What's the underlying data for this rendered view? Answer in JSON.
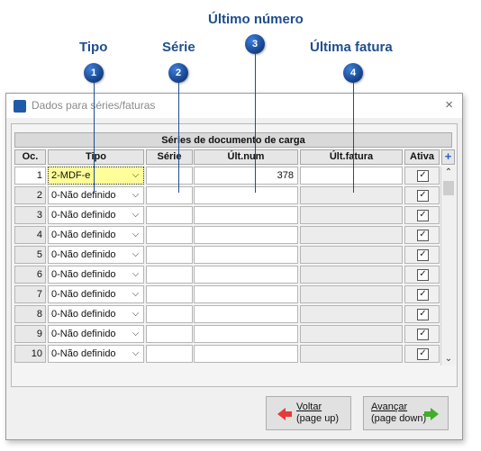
{
  "callouts": [
    {
      "title": "Tipo",
      "num": "1"
    },
    {
      "title": "Série",
      "num": "2"
    },
    {
      "title": "Último número",
      "num": "3"
    },
    {
      "title": "Última fatura",
      "num": "4"
    }
  ],
  "window": {
    "title": "Dados para séries/faturas",
    "close_icon": "×"
  },
  "grid": {
    "section_header": "Séries de documento de carga",
    "columns": [
      "Oc.",
      "Tipo",
      "Série",
      "Últ.num",
      "Últ.fatura",
      "Ativa"
    ],
    "add_icon": "+",
    "dropdown_glyph": "⌵",
    "check_glyph": "✓",
    "rows": [
      {
        "oc": "1",
        "tipo": "2-MDF-e",
        "serie": "",
        "ult_num": "378",
        "ult_fatura": "",
        "ativa": true
      },
      {
        "oc": "2",
        "tipo": "0-Não definido",
        "serie": "",
        "ult_num": "",
        "ult_fatura": "",
        "ativa": true
      },
      {
        "oc": "3",
        "tipo": "0-Não definido",
        "serie": "",
        "ult_num": "",
        "ult_fatura": "",
        "ativa": true
      },
      {
        "oc": "4",
        "tipo": "0-Não definido",
        "serie": "",
        "ult_num": "",
        "ult_fatura": "",
        "ativa": true
      },
      {
        "oc": "5",
        "tipo": "0-Não definido",
        "serie": "",
        "ult_num": "",
        "ult_fatura": "",
        "ativa": true
      },
      {
        "oc": "6",
        "tipo": "0-Não definido",
        "serie": "",
        "ult_num": "",
        "ult_fatura": "",
        "ativa": true
      },
      {
        "oc": "7",
        "tipo": "0-Não definido",
        "serie": "",
        "ult_num": "",
        "ult_fatura": "",
        "ativa": true
      },
      {
        "oc": "8",
        "tipo": "0-Não definido",
        "serie": "",
        "ult_num": "",
        "ult_fatura": "",
        "ativa": true
      },
      {
        "oc": "9",
        "tipo": "0-Não definido",
        "serie": "",
        "ult_num": "",
        "ult_fatura": "",
        "ativa": true
      },
      {
        "oc": "10",
        "tipo": "0-Não definido",
        "serie": "",
        "ult_num": "",
        "ult_fatura": "",
        "ativa": true
      }
    ],
    "scroll_up_glyph": "⌃",
    "scroll_down_glyph": "⌄"
  },
  "buttons": {
    "back": {
      "line1": "Voltar",
      "line2": "(page up)"
    },
    "next": {
      "line1": "Avançar",
      "line2": "(page down)"
    }
  },
  "colors": {
    "callout_blue": "#1f4e8c",
    "selected_yellow": "#ffff99",
    "back_arrow": "#e53b3b",
    "next_arrow": "#3fae2a"
  }
}
